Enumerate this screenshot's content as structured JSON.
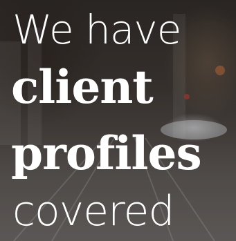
{
  "headline": {
    "line1": "We have",
    "line2": "client",
    "line3": "profiles",
    "line4": "covered"
  },
  "colors": {
    "text": "#ffffff",
    "background_dark": "#2e2a27",
    "background_light": "#6a6765"
  }
}
